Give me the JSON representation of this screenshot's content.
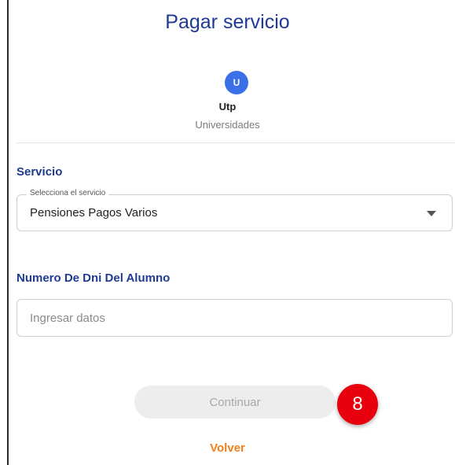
{
  "header": {
    "title": "Pagar servicio"
  },
  "provider": {
    "initial": "U",
    "name": "Utp",
    "category": "Universidades"
  },
  "service": {
    "section_label": "Servicio",
    "select_label": "Selecciona el servicio",
    "selected_value": "Pensiones Pagos Varios"
  },
  "student_id": {
    "section_label": "Numero De Dni Del Alumno",
    "placeholder": "Ingresar datos",
    "value": ""
  },
  "actions": {
    "continue_label": "Continuar",
    "back_label": "Volver"
  },
  "annotation": {
    "step_number": "8"
  },
  "colors": {
    "title": "#1f3a93",
    "avatar": "#3b6fe8",
    "badge": "#e8000e",
    "back_link": "#f07f1d",
    "button_disabled_bg": "#ededed"
  },
  "icons": {
    "select_caret": "caret-down-icon"
  }
}
